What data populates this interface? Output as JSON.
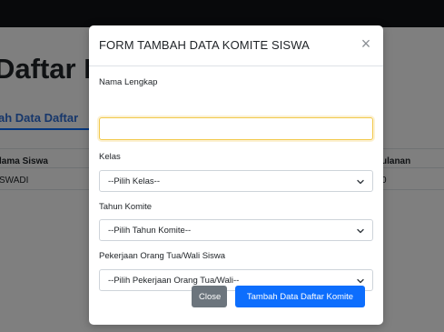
{
  "background": {
    "heading": "Daftar K",
    "tab_label": "ah Data Daftar",
    "table": {
      "headers": [
        "lama Siswa",
        "ulanan"
      ],
      "rows": [
        [
          "SWADI",
          "0"
        ]
      ]
    }
  },
  "modal": {
    "title": "FORM TAMBAH DATA KOMITE SISWA",
    "close_symbol": "×",
    "fields": {
      "nama": {
        "label": "Nama Lengkap",
        "value": "",
        "placeholder": ""
      },
      "kelas": {
        "label": "Kelas",
        "selected": "--Pilih Kelas--"
      },
      "tahun": {
        "label": "Tahun Komite",
        "selected": "--Pilih Tahun Komite--"
      },
      "pekerjaan": {
        "label": "Pekerjaan Orang Tua/Wali Siswa",
        "selected": "--Pilih Pekerjaan Orang Tua/Wali--"
      }
    },
    "buttons": {
      "close": "Close",
      "submit": "Tambah Data Daftar Komite"
    }
  },
  "colors": {
    "primary": "#0d6efd",
    "secondary": "#6c757d",
    "focus_border": "#f2c94c",
    "topbar": "#111316"
  },
  "icons": {
    "close": "close-icon",
    "select_arrow": "chevron-down-icon"
  }
}
